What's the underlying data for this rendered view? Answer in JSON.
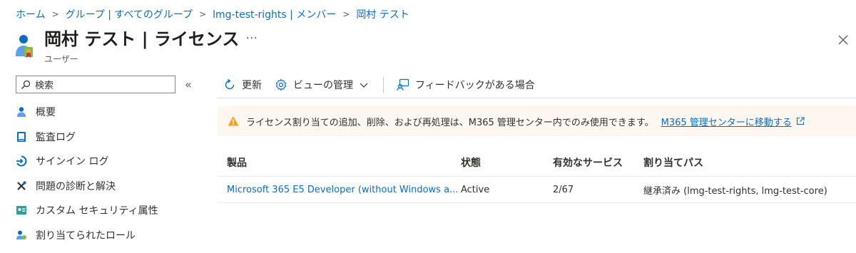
{
  "breadcrumb": {
    "items": [
      "ホーム",
      "グループ | すべてのグループ",
      "lmg-test-rights | メンバー",
      "岡村 テスト"
    ]
  },
  "header": {
    "title": "岡村 テスト | ライセンス",
    "subtitle": "ユーザー",
    "more": "···"
  },
  "sidebar": {
    "search_placeholder": "検索",
    "collapse": "«",
    "items": [
      {
        "label": "概要",
        "icon": "user-icon"
      },
      {
        "label": "監査ログ",
        "icon": "log-icon"
      },
      {
        "label": "サインイン ログ",
        "icon": "signin-icon"
      },
      {
        "label": "問題の診断と解決",
        "icon": "wrench-icon"
      },
      {
        "label": "カスタム セキュリティ属性",
        "icon": "security-attributes-icon"
      },
      {
        "label": "割り当てられたロール",
        "icon": "roles-icon"
      }
    ]
  },
  "toolbar": {
    "refresh": "更新",
    "manage_view": "ビューの管理",
    "feedback": "フィードバックがある場合"
  },
  "warning": {
    "message": "ライセンス割り当ての追加、削除、および再処理は、M365 管理センター内でのみ使用できます。",
    "link": "M365 管理センターに移動する"
  },
  "table": {
    "headers": [
      "製品",
      "状態",
      "有効なサービス",
      "割り当てパス"
    ],
    "rows": [
      {
        "product": "Microsoft 365 E5 Developer (without Windows a...",
        "status": "Active",
        "services": "2/67",
        "path": "継承済み (lmg-test-rights, lmg-test-core)"
      }
    ]
  },
  "colors": {
    "link": "#0f6cbd",
    "warning_bg": "#fdf6f1",
    "warning_icon": "#f7a41d"
  }
}
